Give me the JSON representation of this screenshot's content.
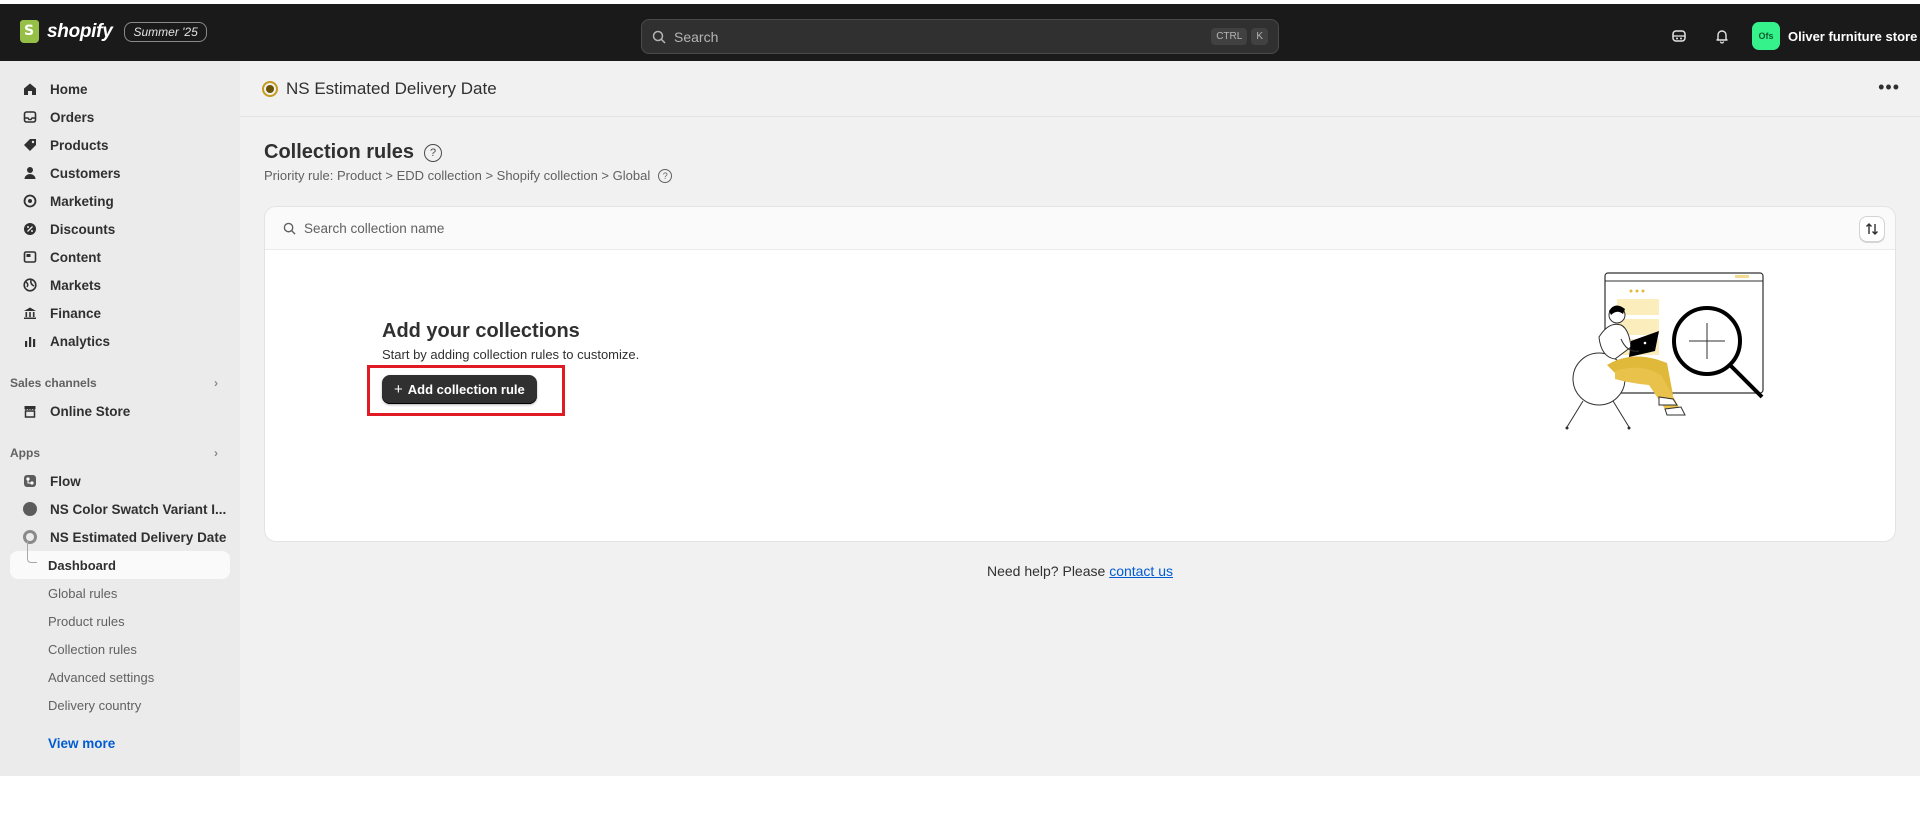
{
  "topbar": {
    "logo_text": "shopify",
    "edition_badge": "Summer '25",
    "search_placeholder": "Search",
    "shortcut_ctrl": "CTRL",
    "shortcut_k": "K",
    "store_initials": "Ofs",
    "store_name": "Oliver furniture store"
  },
  "sidebar": {
    "items": [
      {
        "label": "Home",
        "icon": "home-icon"
      },
      {
        "label": "Orders",
        "icon": "inbox-icon"
      },
      {
        "label": "Products",
        "icon": "tag-icon"
      },
      {
        "label": "Customers",
        "icon": "person-icon"
      },
      {
        "label": "Marketing",
        "icon": "target-icon"
      },
      {
        "label": "Discounts",
        "icon": "discount-icon"
      },
      {
        "label": "Content",
        "icon": "content-icon"
      },
      {
        "label": "Markets",
        "icon": "globe-icon"
      },
      {
        "label": "Finance",
        "icon": "bank-icon"
      },
      {
        "label": "Analytics",
        "icon": "chart-icon"
      }
    ],
    "sales_channels_label": "Sales channels",
    "online_store": "Online Store",
    "apps_label": "Apps",
    "apps": [
      {
        "label": "Flow"
      },
      {
        "label": "NS Color Swatch Variant I..."
      },
      {
        "label": "NS Estimated Delivery Date"
      }
    ],
    "sub_items": [
      "Dashboard",
      "Global rules",
      "Product rules",
      "Collection rules",
      "Advanced settings",
      "Delivery country"
    ],
    "view_more": "View more"
  },
  "page": {
    "app_title": "NS Estimated Delivery Date",
    "section_title": "Collection rules",
    "priority_rule": "Priority rule: Product > EDD collection > Shopify collection > Global",
    "search_placeholder": "Search collection name",
    "empty_title": "Add your collections",
    "empty_desc": "Start by adding collection rules to customize.",
    "add_button": "Add collection rule",
    "help_prefix": "Need help? Please",
    "help_link": "contact us"
  },
  "colors": {
    "topbar_bg": "#1a1a1a",
    "primary_button": "#303030",
    "link": "#005bd3",
    "highlight_box": "#e01b24",
    "illustration_accent": "#e0b93b"
  }
}
